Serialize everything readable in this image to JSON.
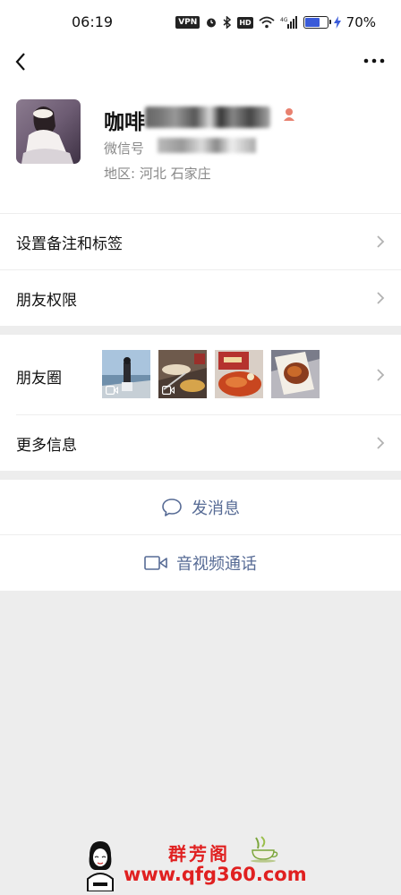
{
  "status_bar": {
    "time": "06:19",
    "vpn": "VPN",
    "hd": "HD",
    "network": "4G",
    "battery_percent": "70%",
    "battery_level": 0.7
  },
  "profile": {
    "name_prefix": "咖啡",
    "wechat_id_label": "微信号",
    "region_label": "地区:",
    "region_value": "河北  石家庄"
  },
  "rows": {
    "remark_tags": "设置备注和标签",
    "friend_permissions": "朋友权限",
    "moments": "朋友圈",
    "more_info": "更多信息"
  },
  "actions": {
    "send_message": "发消息",
    "video_call": "音视频通话"
  },
  "watermark": {
    "brand": "群芳阁",
    "url": "www.qfg360.com"
  },
  "colors": {
    "link_blue": "#576b95",
    "watermark_red": "#e02020"
  }
}
